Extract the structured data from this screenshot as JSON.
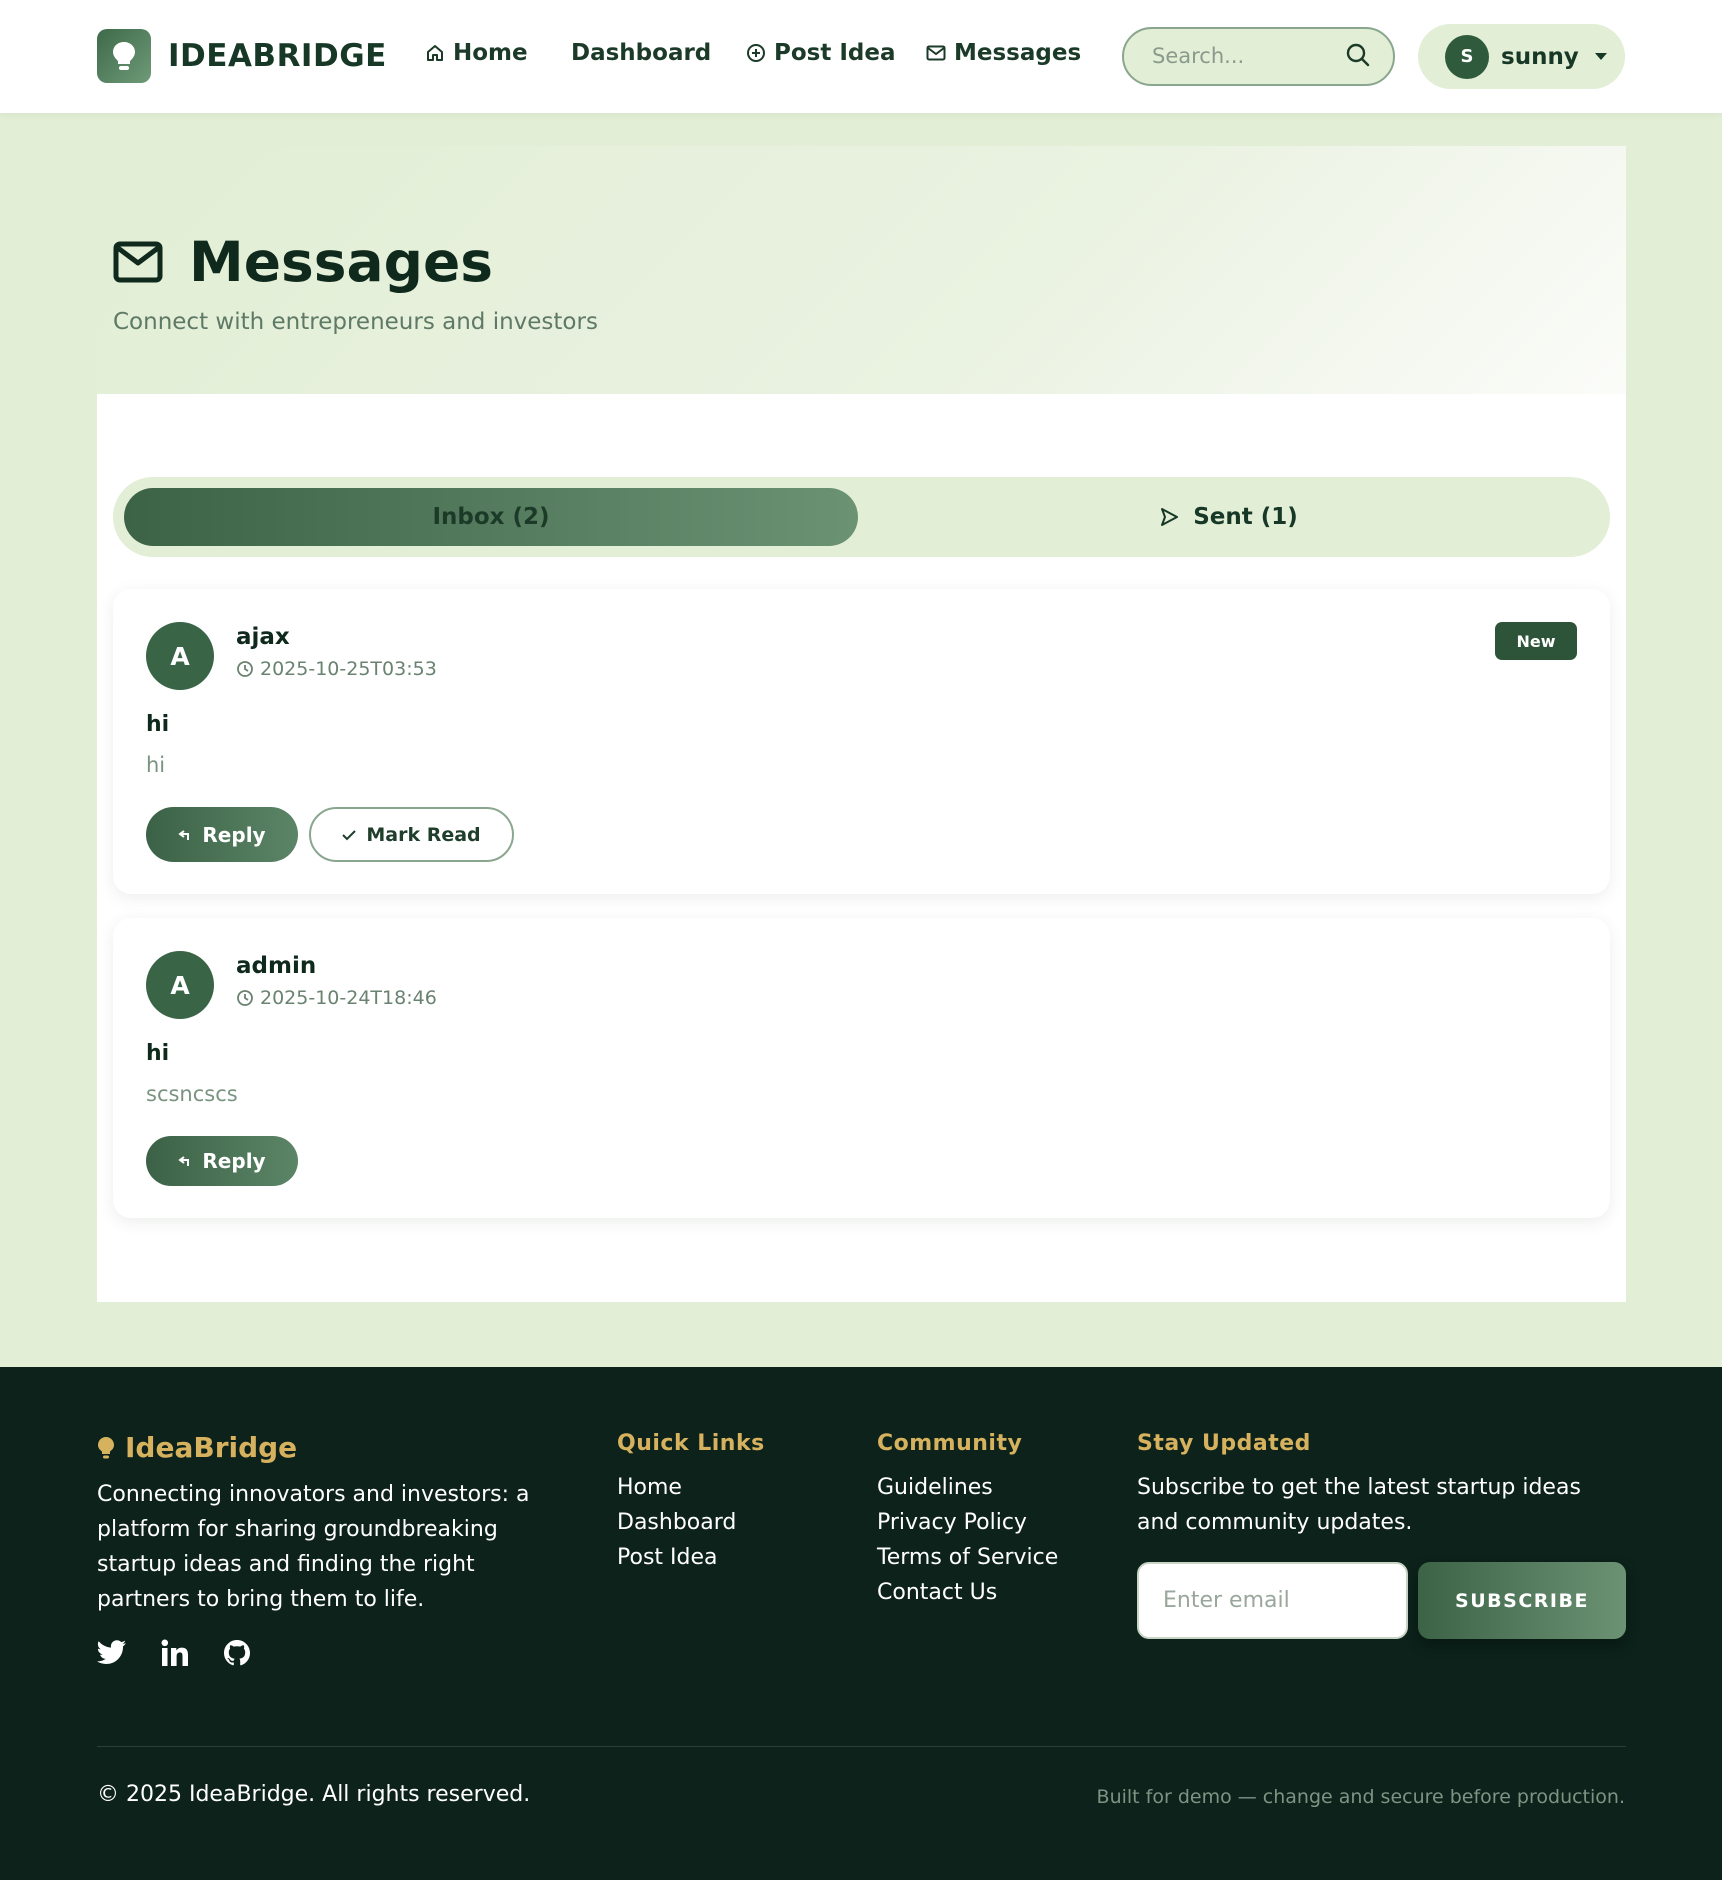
{
  "nav": {
    "brand": "IDEABRIDGE",
    "links": [
      {
        "label": "Home",
        "icon": "home-icon"
      },
      {
        "label": "Dashboard"
      },
      {
        "label": "Post Idea",
        "icon": "plus-circle-icon"
      },
      {
        "label": "Messages",
        "icon": "mail-icon"
      }
    ],
    "search_placeholder": "Search...",
    "user": {
      "initial": "S",
      "name": "sunny"
    }
  },
  "hero": {
    "title": "Messages",
    "subtitle": "Connect with entrepreneurs and investors"
  },
  "tabs": {
    "inbox": "Inbox (2)",
    "sent": "Sent (1)"
  },
  "messages": [
    {
      "initial": "A",
      "sender": "ajax",
      "time": "2025-10-25T03:53",
      "subject": "hi",
      "body": "hi",
      "badge": "New",
      "reply_label": "Reply",
      "mark_read_label": "Mark Read"
    },
    {
      "initial": "A",
      "sender": "admin",
      "time": "2025-10-24T18:46",
      "subject": "hi",
      "body": "scsncscs",
      "reply_label": "Reply"
    }
  ],
  "footer": {
    "brand": "IdeaBridge",
    "about": "Connecting innovators and investors: a platform for sharing groundbreaking startup ideas and finding the right partners to bring them to life.",
    "quick_links": {
      "title": "Quick Links",
      "items": [
        "Home",
        "Dashboard",
        "Post Idea"
      ]
    },
    "community": {
      "title": "Community",
      "items": [
        "Guidelines",
        "Privacy Policy",
        "Terms of Service",
        "Contact Us"
      ]
    },
    "newsletter": {
      "title": "Stay Updated",
      "text": "Subscribe to get the latest startup ideas and community updates.",
      "email_placeholder": "Enter email",
      "button": "SUBSCRIBE"
    },
    "copyright": "© 2025 IdeaBridge. All rights reserved.",
    "note": "Built for demo — change and secure before production."
  },
  "colors": {
    "accent": "#3a6446",
    "background": "#e2eed5",
    "footer_bg": "#0c221a",
    "footer_heading": "#d7b25e"
  }
}
